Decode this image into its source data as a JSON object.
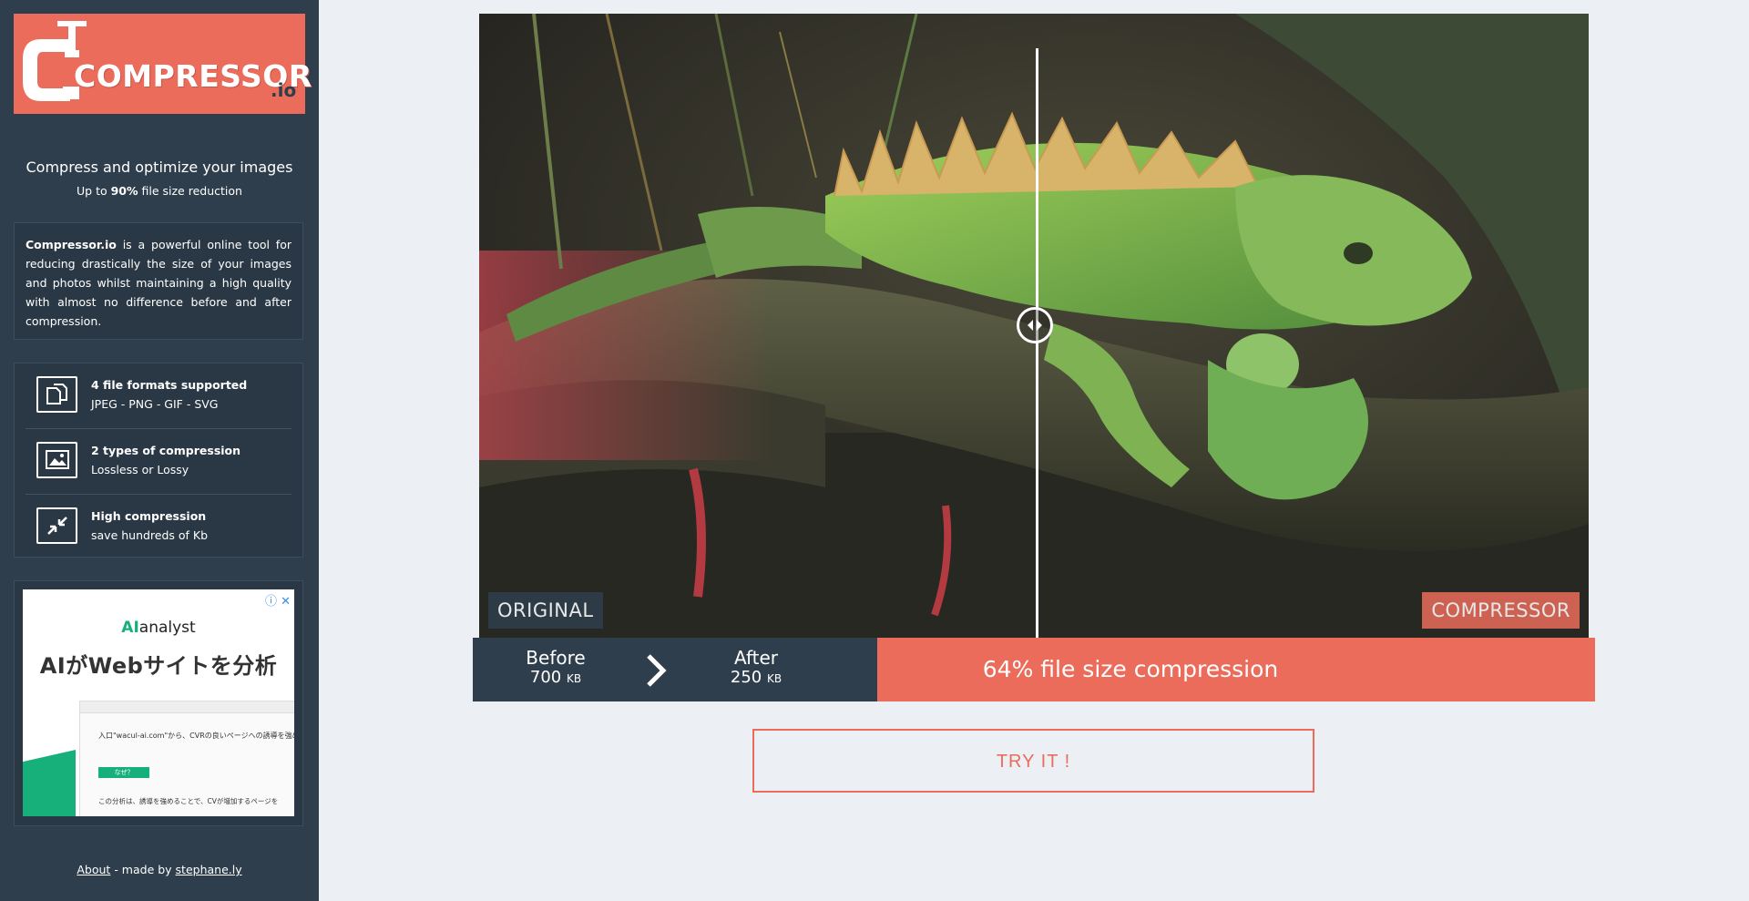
{
  "brand": {
    "name": "COMPRESSOR",
    "tld": ".io",
    "color_primary": "#eb6c5b",
    "color_sidebar": "#2f3e4c"
  },
  "sidebar": {
    "tagline": "Compress and optimize your images",
    "subtagline_prefix": "Up to ",
    "subtagline_highlight": "90%",
    "subtagline_suffix": " file size reduction",
    "description_brand": "Compressor.io",
    "description_text": " is a powerful online tool for reducing drastically the size of your images and photos whilst maintaining a high quality with almost no difference before and after compression.",
    "features": [
      {
        "icon": "files-icon",
        "title": "4 file formats supported",
        "subtitle": "JPEG - PNG - GIF - SVG"
      },
      {
        "icon": "image-icon",
        "title": "2 types of compression",
        "subtitle": "Lossless or Lossy"
      },
      {
        "icon": "compress-arrows-icon",
        "title": "High compression",
        "subtitle": "save hundreds of Kb"
      }
    ],
    "footer": {
      "about_label": "About",
      "made_by_text": " - made by ",
      "author_label": "stephane.ly"
    }
  },
  "ad": {
    "badge": "ⓘ ✕",
    "brand_ai": "AI",
    "brand_rest": "analyst",
    "headline": "AIがWebサイトを分析",
    "mock_text": "入口\"wacul-ai.com\"から、CVRの良いページへの誘導を強め",
    "mock_button": "なぜ？",
    "mock_warning": "この分析は、誘導を強めることで、CVが増加するページを"
  },
  "comparison": {
    "label_left": "ORIGINAL",
    "label_right": "COMPRESSOR",
    "slider_icon": "left-right-arrows-icon"
  },
  "stats": {
    "before_label": "Before",
    "before_value": "700",
    "before_unit": "KB",
    "after_label": "After",
    "after_value": "250",
    "after_unit": "KB",
    "arrow_icon": "chevron-right-icon",
    "compression_text": "64% file size compression"
  },
  "cta": {
    "label": "TRY IT !"
  }
}
